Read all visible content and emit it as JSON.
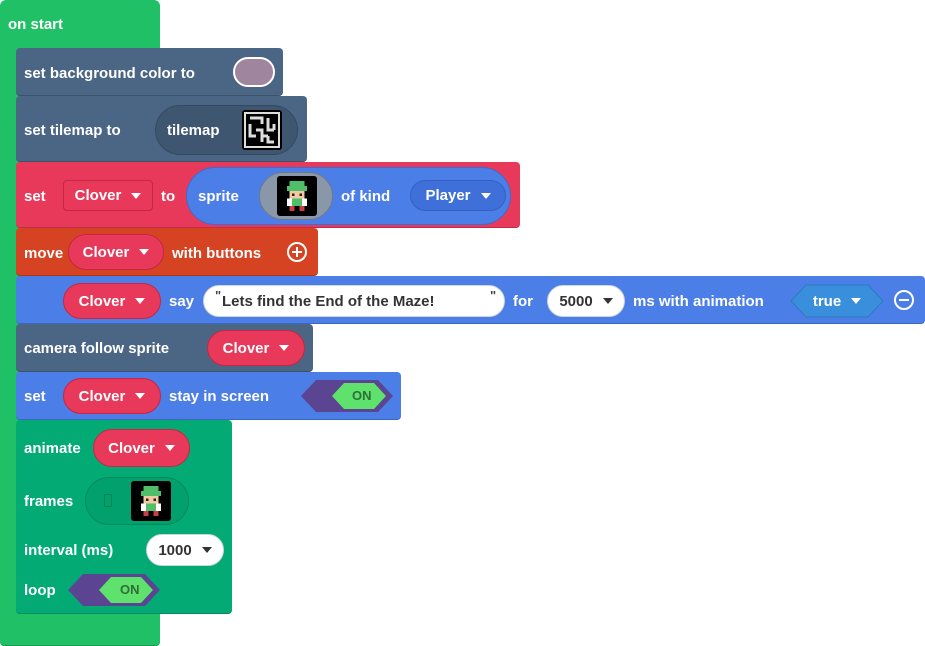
{
  "colors": {
    "event": "#20c066",
    "scene": "#4b6584",
    "variables": "#e8395a",
    "sprite_blue": "#4b7ee6",
    "controller": "#d54322",
    "animation": "#03aa74",
    "toggle_bg": "#5b4592",
    "toggle_on": "#5fe16d",
    "swatch": "#a0859f"
  },
  "on_start": {
    "label": "on start"
  },
  "background": {
    "label": "set background color to",
    "swatch_color": "#a0859f"
  },
  "tilemap": {
    "label": "set tilemap to",
    "value_label": "tilemap",
    "thumb_icon": "maze-tilemap-icon"
  },
  "set_sprite": {
    "set_label": "set",
    "variable": "Clover",
    "to_label": "to",
    "sprite_label": "sprite",
    "of_kind_label": "of kind",
    "kind": "Player",
    "sprite_icon": "hero-sprite-icon"
  },
  "move": {
    "move_label": "move",
    "variable": "Clover",
    "with_buttons_label": "with buttons",
    "expand_icon": "plus-circle-icon"
  },
  "say": {
    "variable": "Clover",
    "say_label": "say",
    "open_quote": "\"",
    "text": "Lets find the End of the Maze!",
    "close_quote": "\"",
    "for_label": "for",
    "duration": "5000",
    "ms_label": "ms with animation",
    "animation": "true",
    "collapse_icon": "minus-circle-icon"
  },
  "camera": {
    "label": "camera follow sprite",
    "variable": "Clover"
  },
  "stay": {
    "set_label": "set",
    "variable": "Clover",
    "stay_label": "stay in screen",
    "toggle": "ON"
  },
  "animate": {
    "animate_label": "animate",
    "variable": "Clover",
    "frames_label": "frames",
    "frames_icon": "hero-sprite-icon",
    "interval_label": "interval (ms)",
    "interval": "1000",
    "loop_label": "loop",
    "loop_toggle": "ON"
  }
}
